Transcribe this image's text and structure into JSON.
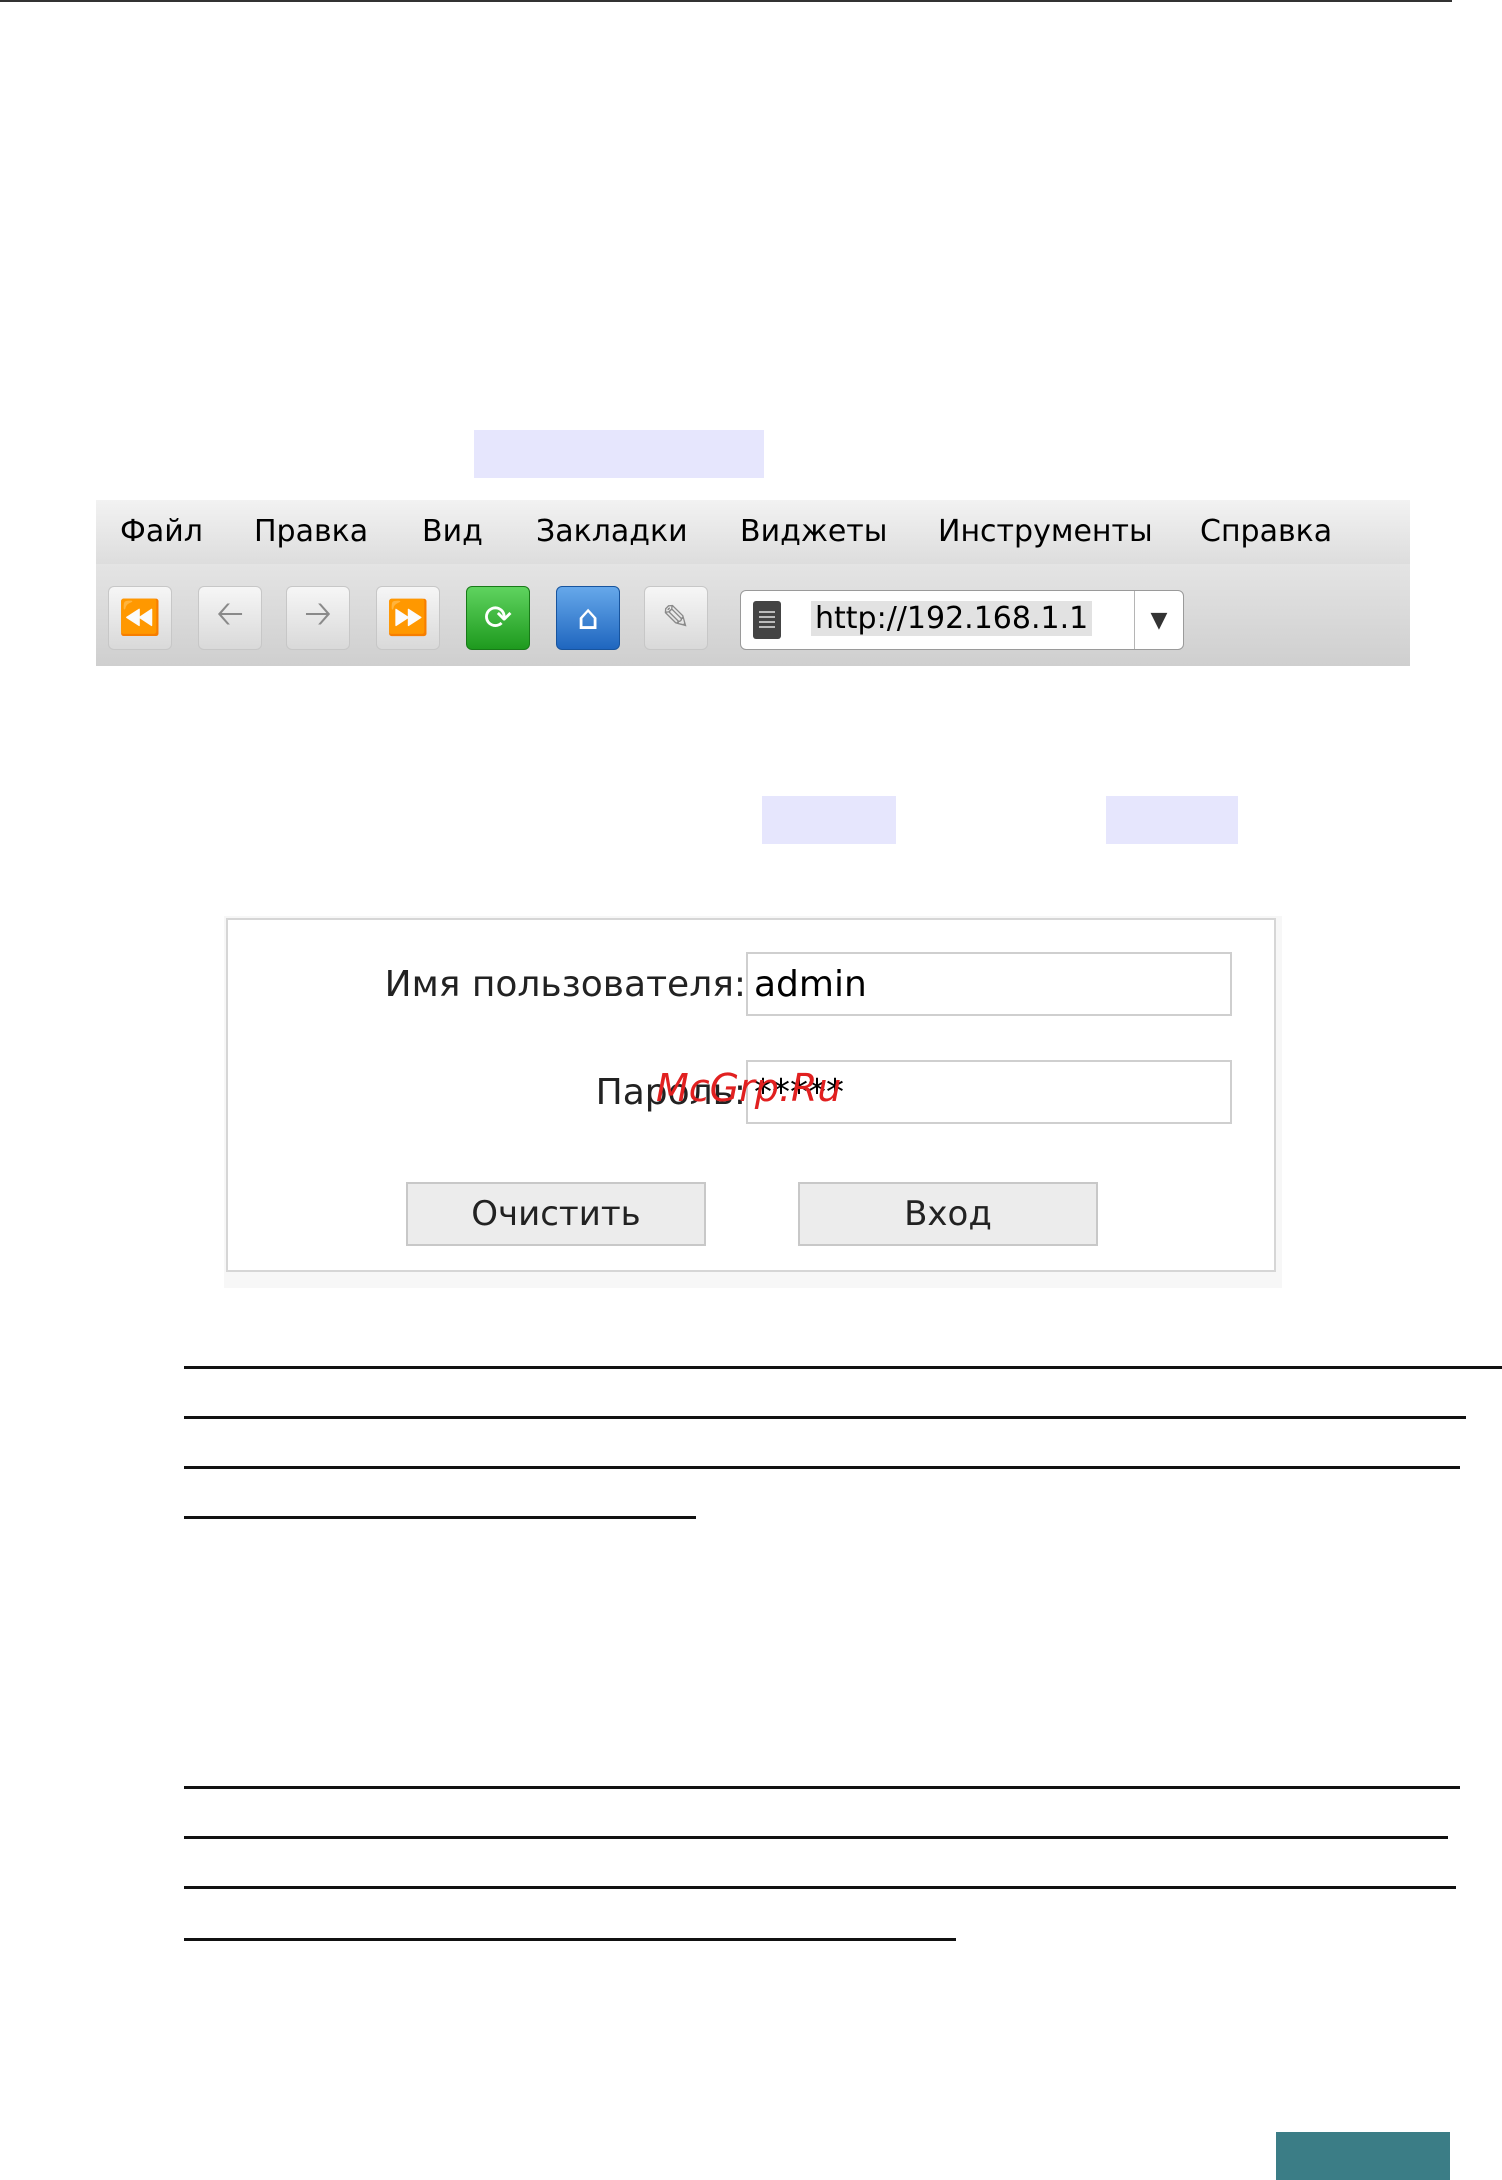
{
  "browser": {
    "menu": [
      "Файл",
      "Правка",
      "Вид",
      "Закладки",
      "Виджеты",
      "Инструменты",
      "Справка"
    ],
    "toolbar_icons": [
      "rewind-icon",
      "back-icon",
      "forward-icon",
      "fast-forward-icon",
      "reload-icon",
      "home-icon",
      "edit-icon"
    ],
    "address": "http://192.168.1.1"
  },
  "login": {
    "username_label": "Имя пользователя:",
    "username_value": "admin",
    "password_label": "Пароль:",
    "password_value": "*****",
    "clear_button": "Очистить",
    "login_button": "Вход"
  },
  "watermark": "McGrp.Ru",
  "colors": {
    "highlight": "#e6e6fd",
    "reload_green": "#2aa62a",
    "home_blue": "#2b72c8",
    "footer_teal": "#3b7d86",
    "watermark_red": "#e12020"
  }
}
